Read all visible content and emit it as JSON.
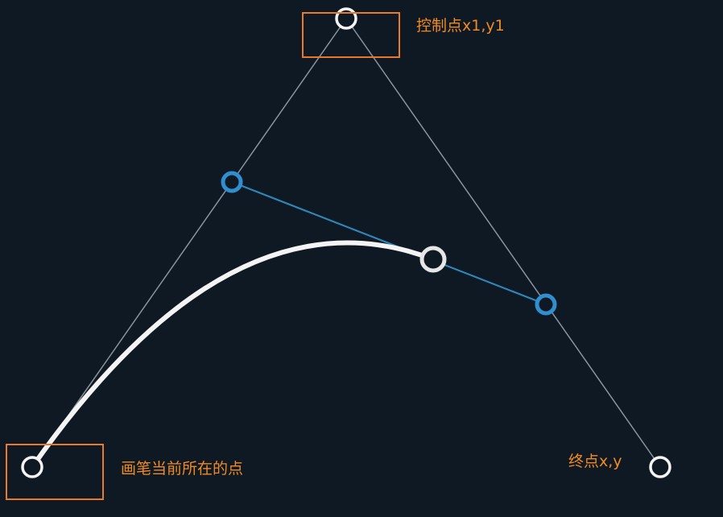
{
  "colors": {
    "background": "#0f1923",
    "guide_line": "#8a949c",
    "tangent_line": "#2f86b8",
    "blue_point": "#2f8fcf",
    "curve": "#f4f4f4",
    "annotation": "#f08a24",
    "annotation_box": "#e8782a"
  },
  "labels": {
    "control_point": "控制点x1,y1",
    "start_point": "画笔当前所在的点",
    "end_point": "终点x,y"
  }
}
